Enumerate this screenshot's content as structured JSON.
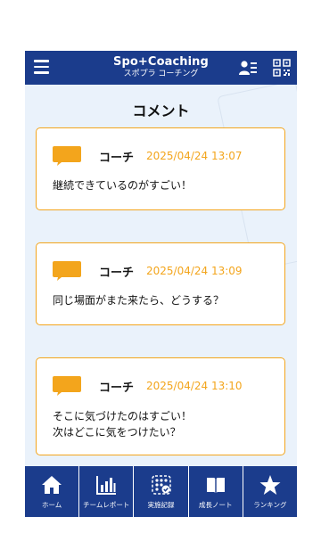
{
  "header": {
    "title": "Spo+Coaching",
    "subtitle": "スポプラ コーチング",
    "menu_icon": "hamburger-menu-icon",
    "user_icon": "user-list-icon",
    "qr_icon": "qr-code-icon"
  },
  "page_title": "コメント",
  "comments": [
    {
      "author": "コーチ",
      "timestamp": "2025/04/24 13:07",
      "lines": [
        "継続できているのがすごい！"
      ]
    },
    {
      "author": "コーチ",
      "timestamp": "2025/04/24 13:09",
      "lines": [
        "同じ場面がまた来たら、どうする？"
      ]
    },
    {
      "author": "コーチ",
      "timestamp": "2025/04/24 13:10",
      "lines": [
        "そこに気づけたのはすごい！",
        "次はどこに気をつけたい？"
      ]
    }
  ],
  "nav": [
    {
      "label": "ホーム",
      "icon": "home-icon"
    },
    {
      "label": "チームレポート",
      "icon": "bar-chart-icon"
    },
    {
      "label": "実施記録",
      "icon": "calendar-check-icon"
    },
    {
      "label": "成長ノート",
      "icon": "notebook-icon"
    },
    {
      "label": "ランキング",
      "icon": "star-icon"
    }
  ],
  "colors": {
    "primary": "#1b3c8c",
    "accent": "#f3a51c",
    "background": "#eaf2fb"
  }
}
